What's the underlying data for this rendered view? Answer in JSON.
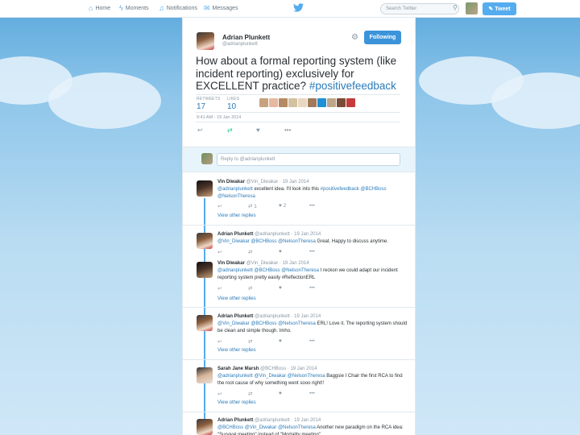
{
  "nav": {
    "home": "Home",
    "moments": "Moments",
    "notifications": "Notifications",
    "messages": "Messages",
    "search_placeholder": "Search Twitter",
    "tweet_button": "Tweet"
  },
  "tweet": {
    "name": "Adrian Plunkett",
    "handle": "@adrianplunkett",
    "follow_label": "Following",
    "text": "How about a formal reporting system (like incident reporting) exclusively for EXCELLENT practice?",
    "hashtag": "#positivefeedback",
    "retweets_label": "RETWEETS",
    "retweets": "17",
    "likes_label": "LIKES",
    "likes": "10",
    "timestamp": "9:41 AM - 19 Jan 2014"
  },
  "reply_box": {
    "placeholder": "Reply to @adrianplunkett"
  },
  "replies": [
    {
      "name": "Vin Diwakar",
      "meta": "@Vin_Diwakar · 19 Jan 2014",
      "mentions": "@adrianplunkett",
      "text": "excellent idea. I'll look into this",
      "tail": "#positivefeedback @BCHBoss @NelsonTheresa",
      "retweets": "1",
      "likes": "2",
      "view_replies": "View other replies"
    },
    {
      "name": "Adrian Plunkett",
      "meta": "@adrianplunkett · 19 Jan 2014",
      "mentions": "@Vin_Diwakar @BCHBoss @NelsonTheresa",
      "text": "Great. Happy to discuss anytime."
    },
    {
      "name": "Vin Diwakar",
      "meta": "@Vin_Diwakar · 19 Jan 2014",
      "mentions": "@adrianplunkett @BCHBoss @NelsonTheresa",
      "text": "I reckon we could adapt our incident reporting system pretty easily #ReflectionERL",
      "view_replies": "View other replies"
    },
    {
      "name": "Adrian Plunkett",
      "meta": "@adrianplunkett · 19 Jan 2014",
      "mentions": "@Vin_Diwakar @BCHBoss @NelsonTheresa",
      "text": "ERL! Love it. The reporting system should be clean and simple though. Imho.",
      "view_replies": "View other replies"
    },
    {
      "name": "Sarah Jane Marsh",
      "meta": "@BCHBoss · 19 Jan 2014",
      "mentions": "@adrianplunkett @Vin_Diwakar @NelsonTheresa",
      "text": "Baggsie I Chair the first RCA to find the root cause of why something went sooo right!!",
      "view_replies": "View other replies"
    },
    {
      "name": "Adrian Plunkett",
      "meta": "@adrianplunkett · 19 Jan 2014",
      "mentions": "@BCHBoss @Vin_Diwakar @NelsonTheresa",
      "text": "Another new paradigm on the RCA idea: \"Survival meeting\" instead of \"Mortality meeting\""
    }
  ],
  "colors": {
    "accent": "#55acee",
    "link": "#2b7bb9",
    "retweet": "#19cf86"
  }
}
